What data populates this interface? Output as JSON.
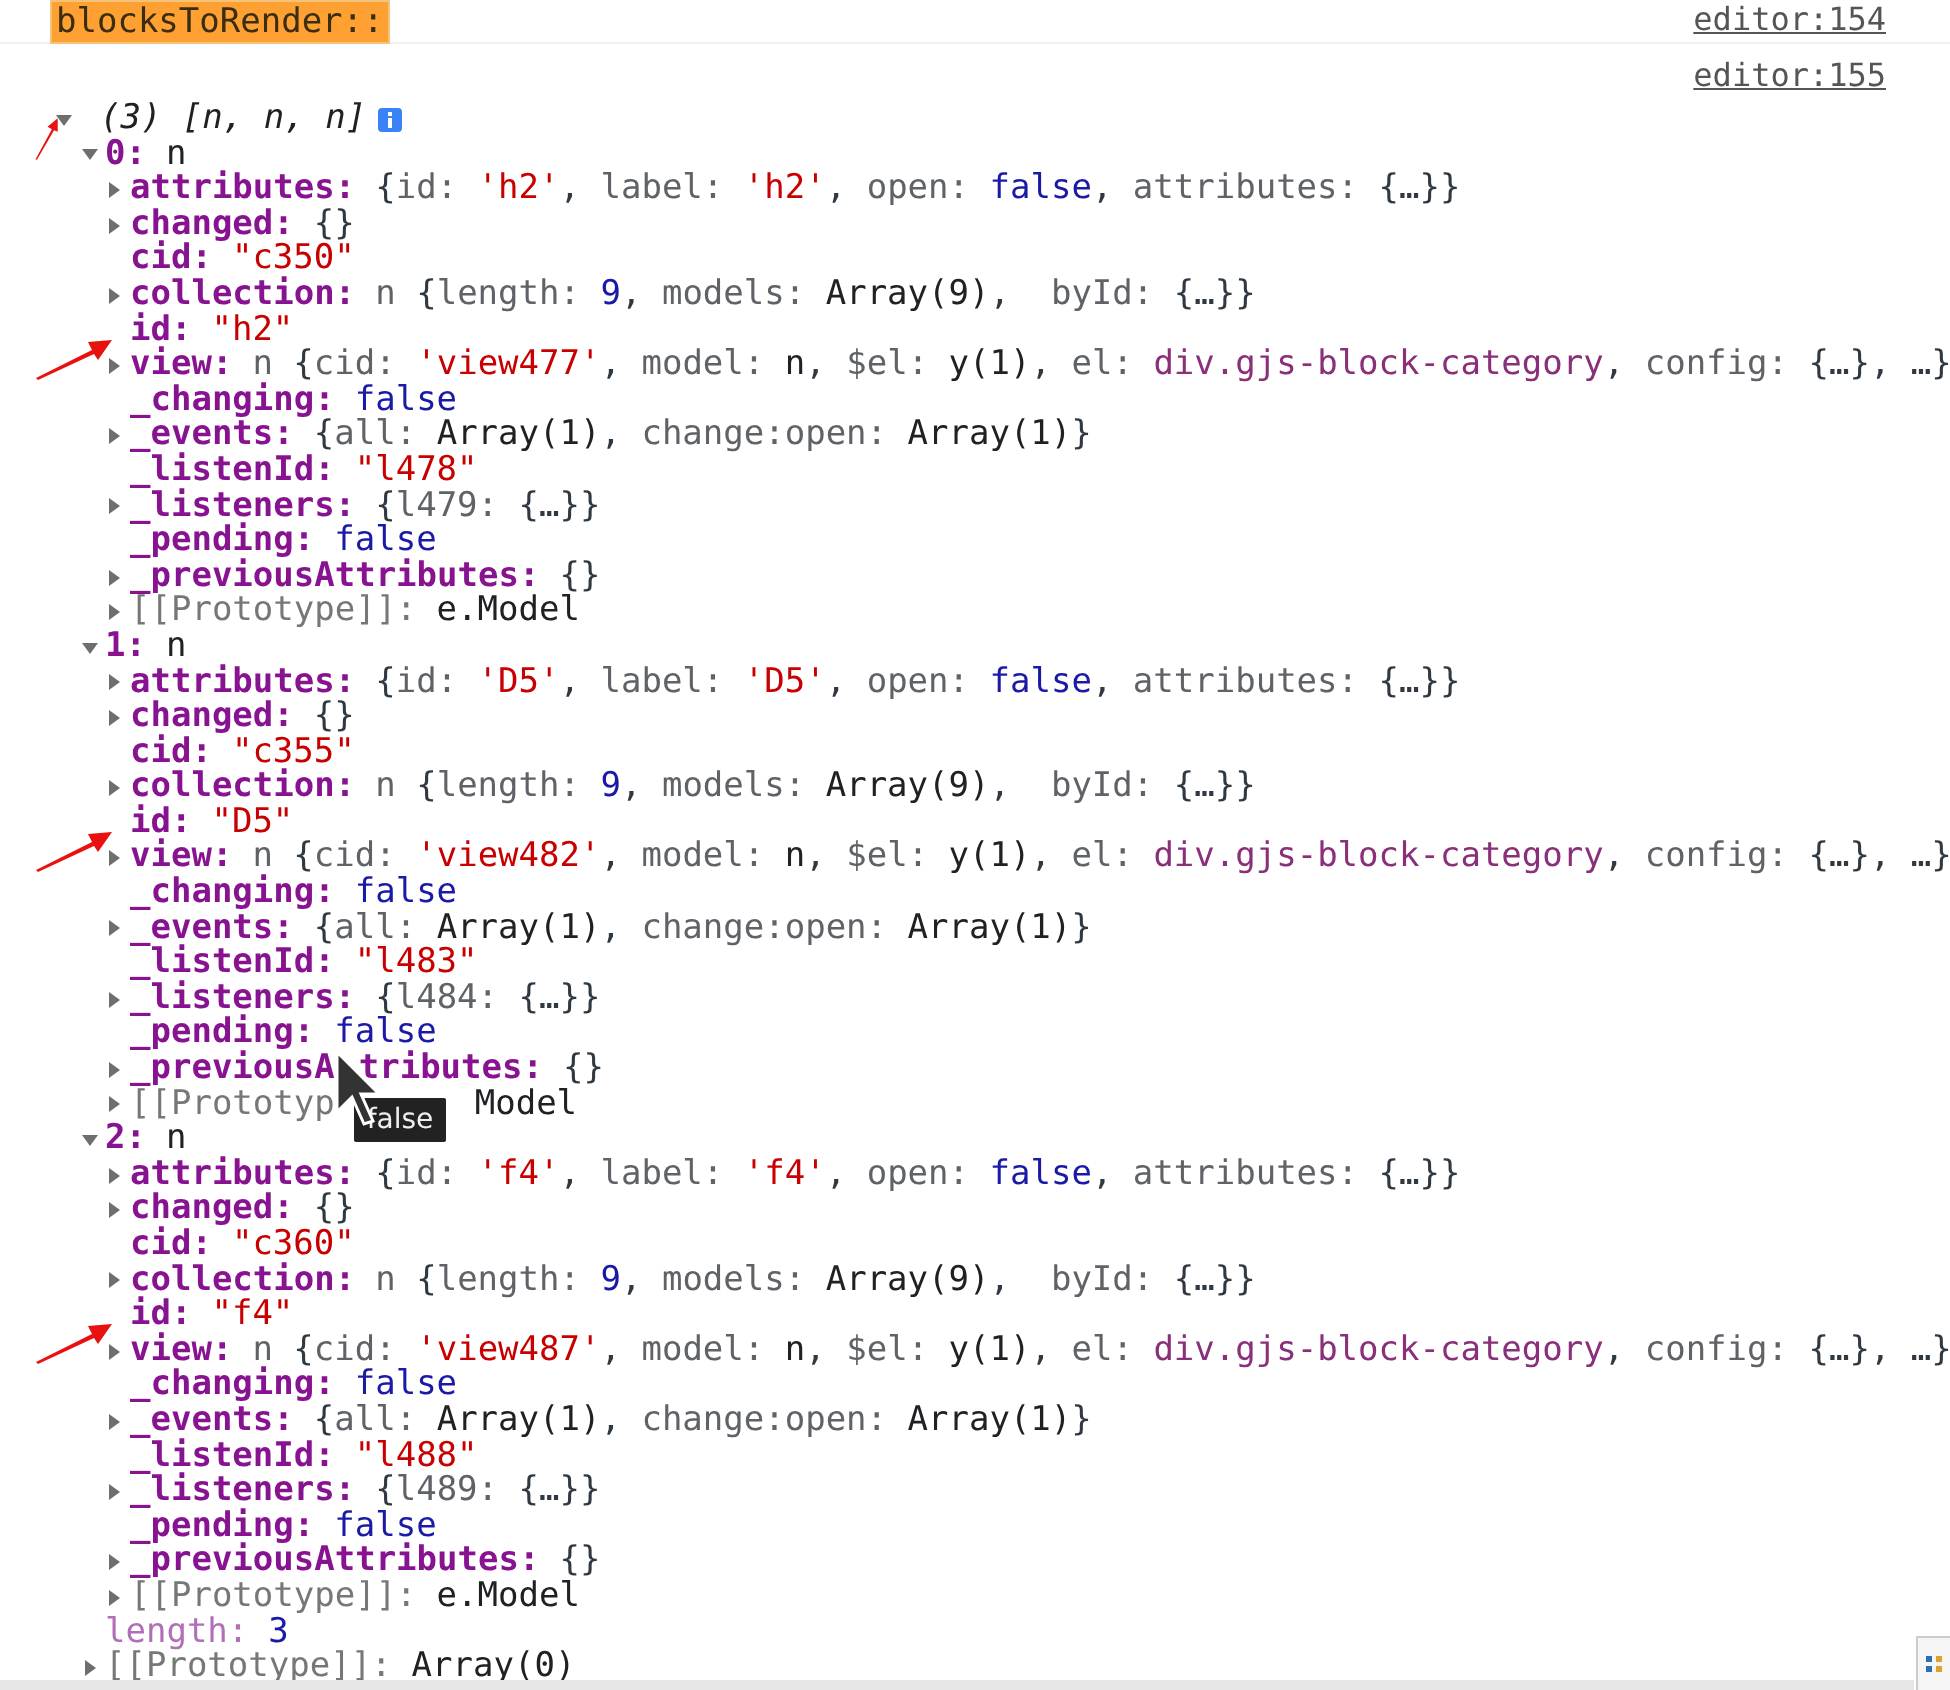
{
  "console": [
    {
      "kind": "label",
      "text": "blocksToRender::",
      "source": "editor:154"
    },
    {
      "kind": "tree",
      "source": "editor:155",
      "root": {
        "kind": "summary",
        "expanded": true,
        "annotated": true,
        "tokens": [
          {
            "kind": "summary",
            "text": "(3) [n, n, n]"
          }
        ],
        "children": [
          {
            "key": "0:",
            "kind": "own",
            "expanded": true,
            "tokens": [
              {
                "kind": "obj",
                "text": "n"
              }
            ],
            "children": [
              {
                "key": "attributes:",
                "kind": "own",
                "expanded": false,
                "tokens": [
                  {
                    "kind": "punct",
                    "text": "{"
                  },
                  {
                    "kind": "key",
                    "text": "id: "
                  },
                  {
                    "kind": "str",
                    "text": "'h2'"
                  },
                  {
                    "kind": "punct",
                    "text": ", "
                  },
                  {
                    "kind": "key",
                    "text": "label: "
                  },
                  {
                    "kind": "str",
                    "text": "'h2'"
                  },
                  {
                    "kind": "punct",
                    "text": ", "
                  },
                  {
                    "kind": "key",
                    "text": "open: "
                  },
                  {
                    "kind": "num",
                    "text": "false"
                  },
                  {
                    "kind": "punct",
                    "text": ", "
                  },
                  {
                    "kind": "key",
                    "text": "attributes: "
                  },
                  {
                    "kind": "punct",
                    "text": "{…}}"
                  }
                ]
              },
              {
                "key": "changed:",
                "kind": "own",
                "expanded": false,
                "tokens": [
                  {
                    "kind": "punct",
                    "text": "{}"
                  }
                ]
              },
              {
                "key": "cid:",
                "kind": "own",
                "tokens": [
                  {
                    "kind": "str",
                    "text": "\"c350\""
                  }
                ]
              },
              {
                "key": "collection:",
                "kind": "own",
                "expanded": false,
                "tokens": [
                  {
                    "kind": "key",
                    "text": "n "
                  },
                  {
                    "kind": "punct",
                    "text": "{"
                  },
                  {
                    "kind": "key",
                    "text": "length: "
                  },
                  {
                    "kind": "num",
                    "text": "9"
                  },
                  {
                    "kind": "punct",
                    "text": ", "
                  },
                  {
                    "kind": "key",
                    "text": "models: "
                  },
                  {
                    "kind": "obj",
                    "text": "Array(9)"
                  },
                  {
                    "kind": "punct",
                    "text": ",  "
                  },
                  {
                    "kind": "key",
                    "text": "byId: "
                  },
                  {
                    "kind": "punct",
                    "text": "{…}}"
                  }
                ]
              },
              {
                "key": "id:",
                "kind": "own",
                "annotated": true,
                "tokens": [
                  {
                    "kind": "str",
                    "text": "\"h2\""
                  }
                ]
              },
              {
                "key": "view:",
                "kind": "own",
                "expanded": false,
                "tokens": [
                  {
                    "kind": "key",
                    "text": "n "
                  },
                  {
                    "kind": "punct",
                    "text": "{"
                  },
                  {
                    "kind": "key",
                    "text": "cid: "
                  },
                  {
                    "kind": "str",
                    "text": "'view477'"
                  },
                  {
                    "kind": "punct",
                    "text": ", "
                  },
                  {
                    "kind": "key",
                    "text": "model: "
                  },
                  {
                    "kind": "obj",
                    "text": "n"
                  },
                  {
                    "kind": "punct",
                    "text": ", "
                  },
                  {
                    "kind": "key",
                    "text": "$el: "
                  },
                  {
                    "kind": "obj",
                    "text": "y(1)"
                  },
                  {
                    "kind": "punct",
                    "text": ", "
                  },
                  {
                    "kind": "key",
                    "text": "el: "
                  },
                  {
                    "kind": "node",
                    "text": "div.gjs-block-category"
                  },
                  {
                    "kind": "punct",
                    "text": ", "
                  },
                  {
                    "kind": "key",
                    "text": "config: "
                  },
                  {
                    "kind": "punct",
                    "text": "{…}, …}"
                  }
                ]
              },
              {
                "key": "_changing:",
                "kind": "own",
                "tokens": [
                  {
                    "kind": "num",
                    "text": "false"
                  }
                ]
              },
              {
                "key": "_events:",
                "kind": "own",
                "expanded": false,
                "tokens": [
                  {
                    "kind": "punct",
                    "text": "{"
                  },
                  {
                    "kind": "key",
                    "text": "all: "
                  },
                  {
                    "kind": "obj",
                    "text": "Array(1)"
                  },
                  {
                    "kind": "punct",
                    "text": ", "
                  },
                  {
                    "kind": "key",
                    "text": "change:open: "
                  },
                  {
                    "kind": "obj",
                    "text": "Array(1)"
                  },
                  {
                    "kind": "punct",
                    "text": "}"
                  }
                ]
              },
              {
                "key": "_listenId:",
                "kind": "own",
                "tokens": [
                  {
                    "kind": "str",
                    "text": "\"l478\""
                  }
                ]
              },
              {
                "key": "_listeners:",
                "kind": "own",
                "expanded": false,
                "tokens": [
                  {
                    "kind": "punct",
                    "text": "{"
                  },
                  {
                    "kind": "key",
                    "text": "l479: "
                  },
                  {
                    "kind": "punct",
                    "text": "{…}}"
                  }
                ]
              },
              {
                "key": "_pending:",
                "kind": "own",
                "tokens": [
                  {
                    "kind": "num",
                    "text": "false"
                  }
                ]
              },
              {
                "key": "_previousAttributes:",
                "kind": "own",
                "expanded": false,
                "tokens": [
                  {
                    "kind": "punct",
                    "text": "{}"
                  }
                ]
              },
              {
                "key": "[[Prototype]]:",
                "kind": "proto",
                "expanded": false,
                "tokens": [
                  {
                    "kind": "obj",
                    "text": "e.Model"
                  }
                ]
              }
            ]
          },
          {
            "key": "1:",
            "kind": "own",
            "expanded": true,
            "tokens": [
              {
                "kind": "obj",
                "text": "n"
              }
            ],
            "children": [
              {
                "key": "attributes:",
                "kind": "own",
                "expanded": false,
                "tokens": [
                  {
                    "kind": "punct",
                    "text": "{"
                  },
                  {
                    "kind": "key",
                    "text": "id: "
                  },
                  {
                    "kind": "str",
                    "text": "'D5'"
                  },
                  {
                    "kind": "punct",
                    "text": ", "
                  },
                  {
                    "kind": "key",
                    "text": "label: "
                  },
                  {
                    "kind": "str",
                    "text": "'D5'"
                  },
                  {
                    "kind": "punct",
                    "text": ", "
                  },
                  {
                    "kind": "key",
                    "text": "open: "
                  },
                  {
                    "kind": "num",
                    "text": "false"
                  },
                  {
                    "kind": "punct",
                    "text": ", "
                  },
                  {
                    "kind": "key",
                    "text": "attributes: "
                  },
                  {
                    "kind": "punct",
                    "text": "{…}}"
                  }
                ]
              },
              {
                "key": "changed:",
                "kind": "own",
                "expanded": false,
                "tokens": [
                  {
                    "kind": "punct",
                    "text": "{}"
                  }
                ]
              },
              {
                "key": "cid:",
                "kind": "own",
                "tokens": [
                  {
                    "kind": "str",
                    "text": "\"c355\""
                  }
                ]
              },
              {
                "key": "collection:",
                "kind": "own",
                "expanded": false,
                "tokens": [
                  {
                    "kind": "key",
                    "text": "n "
                  },
                  {
                    "kind": "punct",
                    "text": "{"
                  },
                  {
                    "kind": "key",
                    "text": "length: "
                  },
                  {
                    "kind": "num",
                    "text": "9"
                  },
                  {
                    "kind": "punct",
                    "text": ", "
                  },
                  {
                    "kind": "key",
                    "text": "models: "
                  },
                  {
                    "kind": "obj",
                    "text": "Array(9)"
                  },
                  {
                    "kind": "punct",
                    "text": ",  "
                  },
                  {
                    "kind": "key",
                    "text": "byId: "
                  },
                  {
                    "kind": "punct",
                    "text": "{…}}"
                  }
                ]
              },
              {
                "key": "id:",
                "kind": "own",
                "annotated": true,
                "tokens": [
                  {
                    "kind": "str",
                    "text": "\"D5\""
                  }
                ]
              },
              {
                "key": "view:",
                "kind": "own",
                "expanded": false,
                "tokens": [
                  {
                    "kind": "key",
                    "text": "n "
                  },
                  {
                    "kind": "punct",
                    "text": "{"
                  },
                  {
                    "kind": "key",
                    "text": "cid: "
                  },
                  {
                    "kind": "str",
                    "text": "'view482'"
                  },
                  {
                    "kind": "punct",
                    "text": ", "
                  },
                  {
                    "kind": "key",
                    "text": "model: "
                  },
                  {
                    "kind": "obj",
                    "text": "n"
                  },
                  {
                    "kind": "punct",
                    "text": ", "
                  },
                  {
                    "kind": "key",
                    "text": "$el: "
                  },
                  {
                    "kind": "obj",
                    "text": "y(1)"
                  },
                  {
                    "kind": "punct",
                    "text": ", "
                  },
                  {
                    "kind": "key",
                    "text": "el: "
                  },
                  {
                    "kind": "node",
                    "text": "div.gjs-block-category"
                  },
                  {
                    "kind": "punct",
                    "text": ", "
                  },
                  {
                    "kind": "key",
                    "text": "config: "
                  },
                  {
                    "kind": "punct",
                    "text": "{…}, …}"
                  }
                ]
              },
              {
                "key": "_changing:",
                "kind": "own",
                "tokens": [
                  {
                    "kind": "num",
                    "text": "false"
                  }
                ]
              },
              {
                "key": "_events:",
                "kind": "own",
                "expanded": false,
                "tokens": [
                  {
                    "kind": "punct",
                    "text": "{"
                  },
                  {
                    "kind": "key",
                    "text": "all: "
                  },
                  {
                    "kind": "obj",
                    "text": "Array(1)"
                  },
                  {
                    "kind": "punct",
                    "text": ", "
                  },
                  {
                    "kind": "key",
                    "text": "change:open: "
                  },
                  {
                    "kind": "obj",
                    "text": "Array(1)"
                  },
                  {
                    "kind": "punct",
                    "text": "}"
                  }
                ]
              },
              {
                "key": "_listenId:",
                "kind": "own",
                "tokens": [
                  {
                    "kind": "str",
                    "text": "\"l483\""
                  }
                ]
              },
              {
                "key": "_listeners:",
                "kind": "own",
                "expanded": false,
                "tokens": [
                  {
                    "kind": "punct",
                    "text": "{"
                  },
                  {
                    "kind": "key",
                    "text": "l484: "
                  },
                  {
                    "kind": "punct",
                    "text": "{…}}"
                  }
                ]
              },
              {
                "key": "_pending:",
                "kind": "own",
                "tokens": [
                  {
                    "kind": "num",
                    "text": "false"
                  }
                ]
              },
              {
                "key": "_previousA",
                "key_after": "tributes:",
                "kind": "own",
                "expanded": false,
                "tokens": [
                  {
                    "kind": "punct",
                    "text": "{}"
                  }
                ]
              },
              {
                "key": "[[Prototyp",
                "kind": "proto",
                "expanded": false,
                "tooltip": "false",
                "tokens": [
                  {
                    "kind": "obj",
                    "text": "Model"
                  }
                ]
              }
            ]
          },
          {
            "key": "2:",
            "kind": "own",
            "expanded": true,
            "tokens": [
              {
                "kind": "obj",
                "text": "n"
              }
            ],
            "children": [
              {
                "key": "attributes:",
                "kind": "own",
                "expanded": false,
                "tokens": [
                  {
                    "kind": "punct",
                    "text": "{"
                  },
                  {
                    "kind": "key",
                    "text": "id: "
                  },
                  {
                    "kind": "str",
                    "text": "'f4'"
                  },
                  {
                    "kind": "punct",
                    "text": ", "
                  },
                  {
                    "kind": "key",
                    "text": "label: "
                  },
                  {
                    "kind": "str",
                    "text": "'f4'"
                  },
                  {
                    "kind": "punct",
                    "text": ", "
                  },
                  {
                    "kind": "key",
                    "text": "open: "
                  },
                  {
                    "kind": "num",
                    "text": "false"
                  },
                  {
                    "kind": "punct",
                    "text": ", "
                  },
                  {
                    "kind": "key",
                    "text": "attributes: "
                  },
                  {
                    "kind": "punct",
                    "text": "{…}}"
                  }
                ]
              },
              {
                "key": "changed:",
                "kind": "own",
                "expanded": false,
                "tokens": [
                  {
                    "kind": "punct",
                    "text": "{}"
                  }
                ]
              },
              {
                "key": "cid:",
                "kind": "own",
                "tokens": [
                  {
                    "kind": "str",
                    "text": "\"c360\""
                  }
                ]
              },
              {
                "key": "collection:",
                "kind": "own",
                "expanded": false,
                "tokens": [
                  {
                    "kind": "key",
                    "text": "n "
                  },
                  {
                    "kind": "punct",
                    "text": "{"
                  },
                  {
                    "kind": "key",
                    "text": "length: "
                  },
                  {
                    "kind": "num",
                    "text": "9"
                  },
                  {
                    "kind": "punct",
                    "text": ", "
                  },
                  {
                    "kind": "key",
                    "text": "models: "
                  },
                  {
                    "kind": "obj",
                    "text": "Array(9)"
                  },
                  {
                    "kind": "punct",
                    "text": ",  "
                  },
                  {
                    "kind": "key",
                    "text": "byId: "
                  },
                  {
                    "kind": "punct",
                    "text": "{…}}"
                  }
                ]
              },
              {
                "key": "id:",
                "kind": "own",
                "annotated": true,
                "tokens": [
                  {
                    "kind": "str",
                    "text": "\"f4\""
                  }
                ]
              },
              {
                "key": "view:",
                "kind": "own",
                "expanded": false,
                "tokens": [
                  {
                    "kind": "key",
                    "text": "n "
                  },
                  {
                    "kind": "punct",
                    "text": "{"
                  },
                  {
                    "kind": "key",
                    "text": "cid: "
                  },
                  {
                    "kind": "str",
                    "text": "'view487'"
                  },
                  {
                    "kind": "punct",
                    "text": ", "
                  },
                  {
                    "kind": "key",
                    "text": "model: "
                  },
                  {
                    "kind": "obj",
                    "text": "n"
                  },
                  {
                    "kind": "punct",
                    "text": ", "
                  },
                  {
                    "kind": "key",
                    "text": "$el: "
                  },
                  {
                    "kind": "obj",
                    "text": "y(1)"
                  },
                  {
                    "kind": "punct",
                    "text": ", "
                  },
                  {
                    "kind": "key",
                    "text": "el: "
                  },
                  {
                    "kind": "node",
                    "text": "div.gjs-block-category"
                  },
                  {
                    "kind": "punct",
                    "text": ", "
                  },
                  {
                    "kind": "key",
                    "text": "config: "
                  },
                  {
                    "kind": "punct",
                    "text": "{…}, …}"
                  }
                ]
              },
              {
                "key": "_changing:",
                "kind": "own",
                "tokens": [
                  {
                    "kind": "num",
                    "text": "false"
                  }
                ]
              },
              {
                "key": "_events:",
                "kind": "own",
                "expanded": false,
                "tokens": [
                  {
                    "kind": "punct",
                    "text": "{"
                  },
                  {
                    "kind": "key",
                    "text": "all: "
                  },
                  {
                    "kind": "obj",
                    "text": "Array(1)"
                  },
                  {
                    "kind": "punct",
                    "text": ", "
                  },
                  {
                    "kind": "key",
                    "text": "change:open: "
                  },
                  {
                    "kind": "obj",
                    "text": "Array(1)"
                  },
                  {
                    "kind": "punct",
                    "text": "}"
                  }
                ]
              },
              {
                "key": "_listenId:",
                "kind": "own",
                "tokens": [
                  {
                    "kind": "str",
                    "text": "\"l488\""
                  }
                ]
              },
              {
                "key": "_listeners:",
                "kind": "own",
                "expanded": false,
                "tokens": [
                  {
                    "kind": "punct",
                    "text": "{"
                  },
                  {
                    "kind": "key",
                    "text": "l489: "
                  },
                  {
                    "kind": "punct",
                    "text": "{…}}"
                  }
                ]
              },
              {
                "key": "_pending:",
                "kind": "own",
                "tokens": [
                  {
                    "kind": "num",
                    "text": "false"
                  }
                ]
              },
              {
                "key": "_previousAttributes:",
                "kind": "own",
                "expanded": false,
                "tokens": [
                  {
                    "kind": "punct",
                    "text": "{}"
                  }
                ]
              },
              {
                "key": "[[Prototype]]:",
                "kind": "proto",
                "expanded": false,
                "tokens": [
                  {
                    "kind": "obj",
                    "text": "e.Model"
                  }
                ]
              }
            ]
          },
          {
            "key": "length:",
            "kind": "meta",
            "tokens": [
              {
                "kind": "num",
                "text": "3"
              }
            ]
          },
          {
            "key": "[[Prototype]]:",
            "kind": "proto",
            "expanded": false,
            "tokens": [
              {
                "kind": "obj",
                "text": "Array(0)"
              }
            ]
          }
        ]
      }
    }
  ]
}
